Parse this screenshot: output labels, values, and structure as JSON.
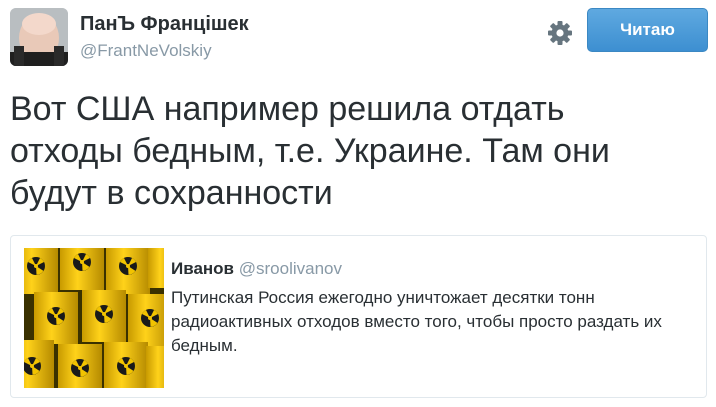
{
  "author": {
    "display_name": "ПанЪ Францішек",
    "handle": "@FrantNeVolskiy"
  },
  "follow_button": {
    "label": "Читаю"
  },
  "icons": {
    "settings": "gear-icon",
    "avatar": "avatar-photo",
    "quote_image": "radioactive-barrels"
  },
  "tweet": {
    "lines": [
      "Вот США например решила отдать",
      "отходы бедным, т.е. Украине. Там они",
      "будут в сохранности"
    ]
  },
  "quoted_tweet": {
    "name": "Иванов",
    "handle": "@sroolivanov",
    "lines": [
      "Путинская Россия ежегодно уничтожает десятки тонн",
      "радиоактивных отходов вместо того, чтобы просто раздать их",
      "бедным."
    ]
  },
  "colors": {
    "button_blue": "#4a9ad8",
    "text": "#292f33",
    "secondary_text": "#8899a6",
    "border": "#e1e8ed",
    "barrel_yellow": "#f2c300"
  }
}
